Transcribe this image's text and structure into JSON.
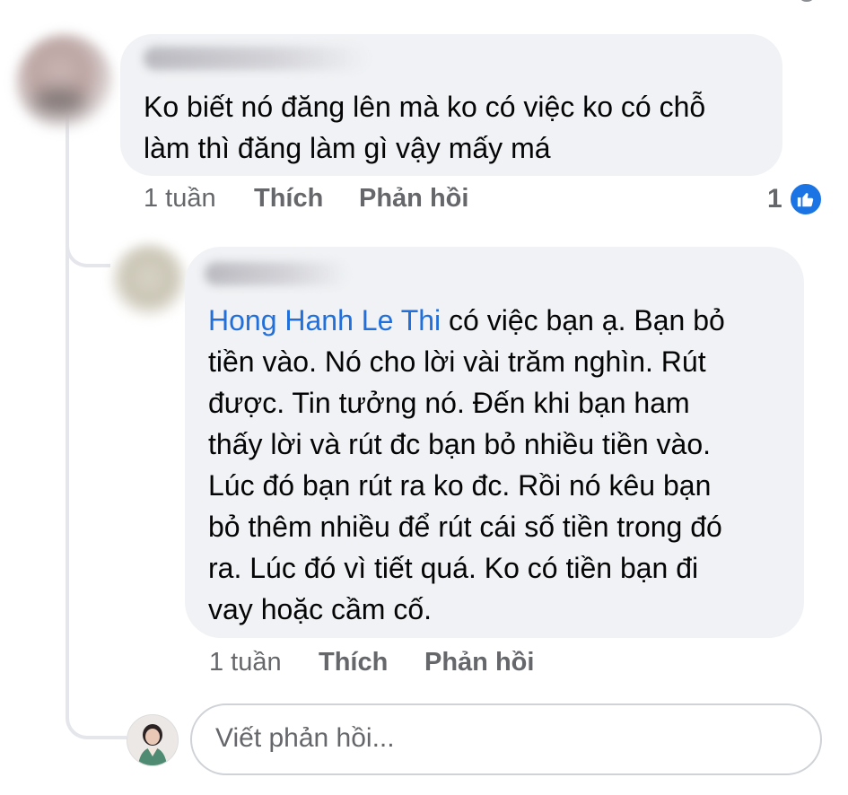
{
  "comment": {
    "text_line1": "Ko biết nó đăng lên mà ko có việc ko có chỗ",
    "text_line2": "làm thì đăng làm gì vậy mấy má",
    "time": "1 tuần",
    "like_label": "Thích",
    "reply_label": "Phản hồi",
    "reaction_count": "1",
    "reaction_icon": "like-icon"
  },
  "reply": {
    "mention": "Hong Hanh Le Thi",
    "text_after_mention": "có việc bạn ạ.  Bạn bỏ",
    "lines": [
      "tiền vào.  Nó cho lời vài trăm nghìn.  Rút",
      "được.  Tin tưởng nó.  Đến khi bạn ham",
      "thấy lời và rút đc bạn bỏ nhiều tiền vào.",
      "Lúc đó bạn rút ra ko đc.  Rồi nó kêu bạn",
      "bỏ thêm nhiều để rút cái số tiền trong đó",
      "ra.  Lúc đó vì tiết quá.  Ko có tiền bạn đi",
      "vay hoặc cầm cố."
    ],
    "time": "1 tuần",
    "like_label": "Thích",
    "reply_label": "Phản hồi"
  },
  "composer": {
    "placeholder": "Viết phản hồi..."
  },
  "colors": {
    "bubble": "#f0f2f5",
    "mention": "#216fdb",
    "meta": "#65676b",
    "like_badge": "#1b74e4"
  }
}
